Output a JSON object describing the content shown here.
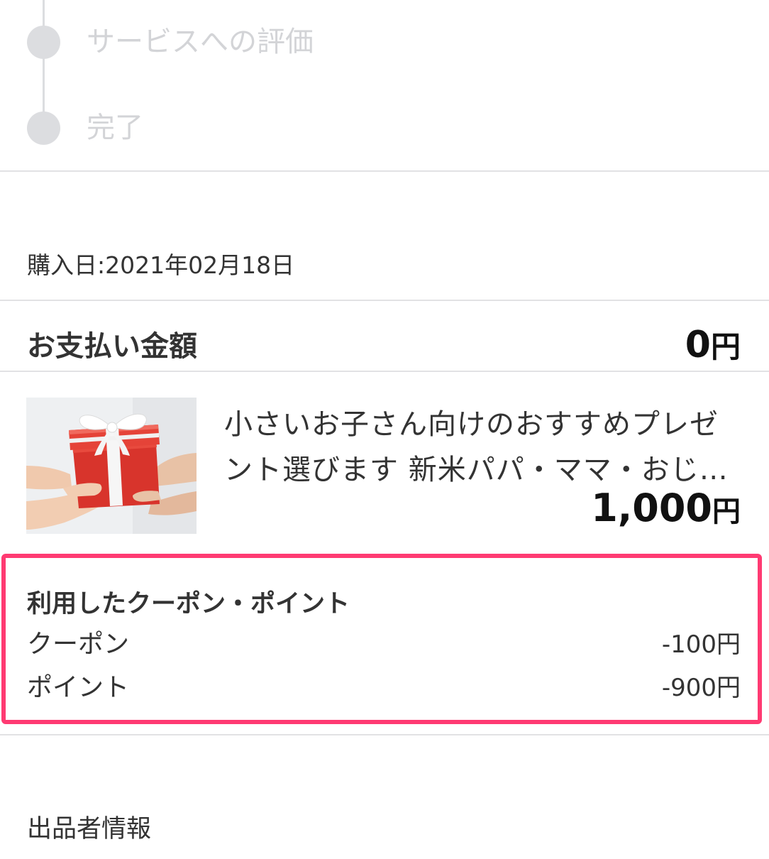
{
  "timeline": {
    "steps": [
      {
        "label": "サービスへの評価"
      },
      {
        "label": "完了"
      }
    ]
  },
  "order": {
    "purchase_date": "購入日:2021年02月18日",
    "payment_label": "お支払い金額",
    "payment_amount": "0",
    "payment_currency": "円"
  },
  "product": {
    "image": "gift-box-photo",
    "title_line1": "小さいお子さん向けのおすすめプレゼ",
    "title_line2": "ント選びます 新米パパ・ママ・おじ…",
    "price": "1,000",
    "currency": "円"
  },
  "coupon_points": {
    "title": "利用したクーポン・ポイント",
    "rows": [
      {
        "label": "クーポン",
        "value": "-100円"
      },
      {
        "label": "ポイント",
        "value": "-900円"
      }
    ],
    "highlight_color": "#ff3a72"
  },
  "seller": {
    "heading": "出品者情報"
  }
}
